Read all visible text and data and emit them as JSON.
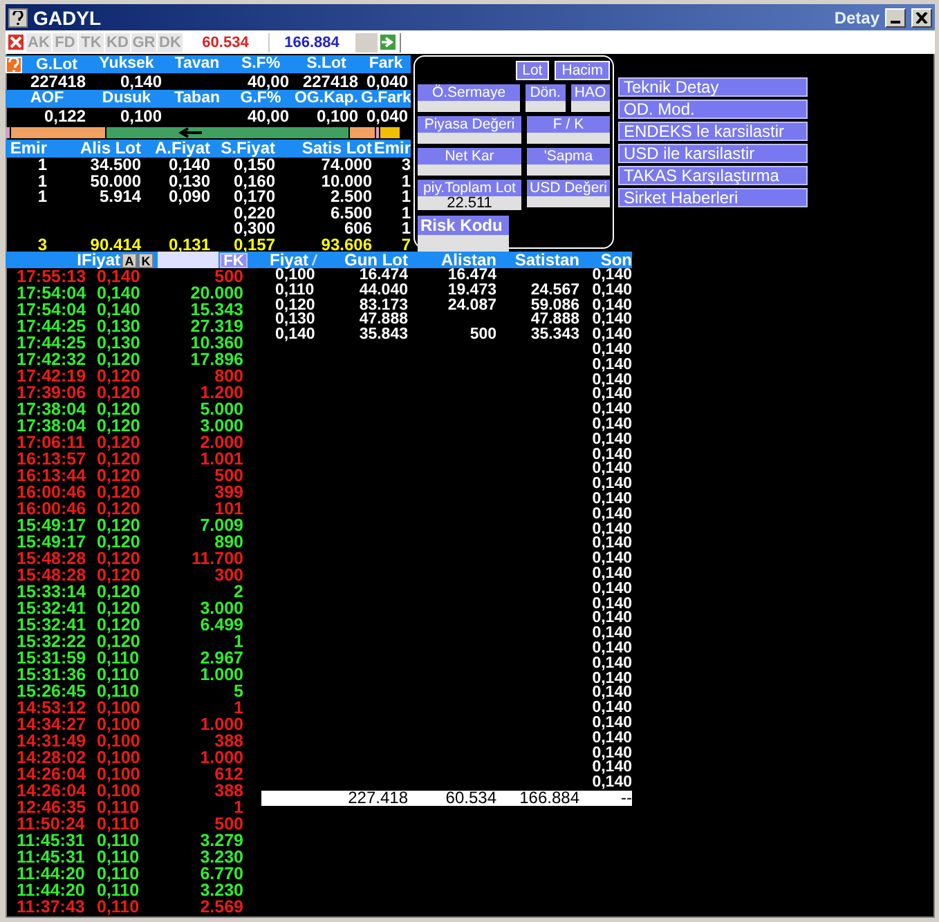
{
  "window": {
    "title": "GADYL",
    "detail_title": "Detay"
  },
  "toolbar": {
    "tabs": [
      "AK",
      "FD",
      "TK",
      "KD",
      "GR",
      "DK"
    ],
    "alistan_total": "60.534",
    "satistan_total": "166.884"
  },
  "quote": [
    {
      "label": "G.Lot",
      "value": "227418"
    },
    {
      "label": "Yuksek",
      "value": "0,140"
    },
    {
      "label": "Tavan"
    },
    {
      "label": "S.F%",
      "value": "40,00"
    },
    {
      "label": "S.Lot",
      "value": "227418"
    },
    {
      "label": "Fark",
      "value": "0,040"
    },
    {
      "label": "AOF",
      "value": "0,122"
    },
    {
      "label": "Dusuk",
      "value": "0,100"
    },
    {
      "label": "Taban"
    },
    {
      "label": "G.F%",
      "value": "40,00"
    },
    {
      "label": "OG.Kap.",
      "value": "0,100"
    },
    {
      "label": "G.Fark",
      "value": "0,040"
    }
  ],
  "depth": {
    "columns": [
      "Emir",
      "Alis Lot",
      "A.Fiyat",
      "S.Fiyat",
      "Satis Lot",
      "Emir"
    ],
    "rows": [
      {
        "emir_buy": "1",
        "alis_lot": "34.500",
        "a_fiyat": "0,140",
        "s_fiyat": "0,150",
        "satis_lot": "74.000",
        "emir_sell": "3"
      },
      {
        "emir_buy": "1",
        "alis_lot": "50.000",
        "a_fiyat": "0,130",
        "s_fiyat": "0,160",
        "satis_lot": "10.000",
        "emir_sell": "1"
      },
      {
        "emir_buy": "1",
        "alis_lot": "5.914",
        "a_fiyat": "0,090",
        "s_fiyat": "0,170",
        "satis_lot": "2.500",
        "emir_sell": "1"
      },
      {
        "s_fiyat": "0,220",
        "satis_lot": "6.500",
        "emir_sell": "1"
      },
      {
        "s_fiyat": "0,300",
        "satis_lot": "606",
        "emir_sell": "1"
      }
    ],
    "total": {
      "emir_buy": "3",
      "alis_lot": "90.414",
      "a_fiyat": "0,131",
      "s_fiyat": "0,157",
      "satis_lot": "93.606",
      "emir_sell": "7"
    }
  },
  "panel": {
    "toggles": [
      "Lot",
      "Hacim"
    ],
    "rows": [
      [
        {
          "label": "Ö.Sermaye"
        },
        {
          "label": "Dön."
        },
        {
          "label": "HAO"
        }
      ],
      [
        {
          "label": "Piyasa Değeri"
        },
        {
          "label": "F / K"
        }
      ],
      [
        {
          "label": "Net Kar"
        },
        {
          "label": "'Sapma"
        }
      ],
      [
        {
          "label": "piy.Toplam Lot",
          "value": "22.511"
        },
        {
          "label": "USD Değeri"
        }
      ]
    ],
    "risk": {
      "label": "Risk Kodu"
    }
  },
  "actions": [
    "Teknik Detay",
    "OD. Mod.",
    "ENDEKS le karsilastir",
    "USD ile karsilastir",
    "TAKAS Karşılaştırma",
    "Sirket Haberleri"
  ],
  "trades": {
    "header": "IFiyat",
    "buttons": [
      "A",
      "K"
    ],
    "filter_button": "FK",
    "rows": [
      {
        "time": "17:55:13",
        "price": "0,140",
        "lot": "500",
        "color": "#ee1a1a"
      },
      {
        "time": "17:54:04",
        "price": "0,140",
        "lot": "20.000",
        "color": "#30ee30"
      },
      {
        "time": "17:54:04",
        "price": "0,140",
        "lot": "15.343",
        "color": "#30ee30"
      },
      {
        "time": "17:44:25",
        "price": "0,130",
        "lot": "27.319",
        "color": "#30ee30"
      },
      {
        "time": "17:44:25",
        "price": "0,130",
        "lot": "10.360",
        "color": "#30ee30"
      },
      {
        "time": "17:42:32",
        "price": "0,120",
        "lot": "17.896",
        "color": "#30ee30"
      },
      {
        "time": "17:42:19",
        "price": "0,120",
        "lot": "800",
        "color": "#ee1a1a"
      },
      {
        "time": "17:39:06",
        "price": "0,120",
        "lot": "1.200",
        "color": "#ee1a1a"
      },
      {
        "time": "17:38:04",
        "price": "0,120",
        "lot": "5.000",
        "color": "#30ee30"
      },
      {
        "time": "17:38:04",
        "price": "0,120",
        "lot": "3.000",
        "color": "#30ee30"
      },
      {
        "time": "17:06:11",
        "price": "0,120",
        "lot": "2.000",
        "color": "#ee1a1a"
      },
      {
        "time": "16:13:57",
        "price": "0,120",
        "lot": "1.001",
        "color": "#ee1a1a"
      },
      {
        "time": "16:13:44",
        "price": "0,120",
        "lot": "500",
        "color": "#ee1a1a"
      },
      {
        "time": "16:00:46",
        "price": "0,120",
        "lot": "399",
        "color": "#ee1a1a"
      },
      {
        "time": "16:00:46",
        "price": "0,120",
        "lot": "101",
        "color": "#ee1a1a"
      },
      {
        "time": "15:49:17",
        "price": "0,120",
        "lot": "7.009",
        "color": "#30ee30"
      },
      {
        "time": "15:49:17",
        "price": "0,120",
        "lot": "890",
        "color": "#30ee30"
      },
      {
        "time": "15:48:28",
        "price": "0,120",
        "lot": "11.700",
        "color": "#ee1a1a"
      },
      {
        "time": "15:48:28",
        "price": "0,120",
        "lot": "300",
        "color": "#ee1a1a"
      },
      {
        "time": "15:33:14",
        "price": "0,120",
        "lot": "2",
        "color": "#30ee30"
      },
      {
        "time": "15:32:41",
        "price": "0,120",
        "lot": "3.000",
        "color": "#30ee30"
      },
      {
        "time": "15:32:41",
        "price": "0,120",
        "lot": "6.499",
        "color": "#30ee30"
      },
      {
        "time": "15:32:22",
        "price": "0,120",
        "lot": "1",
        "color": "#30ee30"
      },
      {
        "time": "15:31:59",
        "price": "0,110",
        "lot": "2.967",
        "color": "#30ee30"
      },
      {
        "time": "15:31:36",
        "price": "0,110",
        "lot": "1.000",
        "color": "#30ee30"
      },
      {
        "time": "15:26:45",
        "price": "0,110",
        "lot": "5",
        "color": "#30ee30"
      },
      {
        "time": "14:53:12",
        "price": "0,100",
        "lot": "1",
        "color": "#ee1a1a"
      },
      {
        "time": "14:34:27",
        "price": "0,100",
        "lot": "1.000",
        "color": "#ee1a1a"
      },
      {
        "time": "14:31:49",
        "price": "0,100",
        "lot": "388",
        "color": "#ee1a1a"
      },
      {
        "time": "14:28:02",
        "price": "0,100",
        "lot": "1.000",
        "color": "#ee1a1a"
      },
      {
        "time": "14:26:04",
        "price": "0,100",
        "lot": "612",
        "color": "#ee1a1a"
      },
      {
        "time": "14:26:04",
        "price": "0,100",
        "lot": "388",
        "color": "#ee1a1a"
      },
      {
        "time": "12:46:35",
        "price": "0,110",
        "lot": "1",
        "color": "#ee1a1a"
      },
      {
        "time": "11:50:24",
        "price": "0,110",
        "lot": "500",
        "color": "#ee1a1a"
      },
      {
        "time": "11:45:31",
        "price": "0,110",
        "lot": "3.279",
        "color": "#30ee30"
      },
      {
        "time": "11:45:31",
        "price": "0,110",
        "lot": "3.230",
        "color": "#30ee30"
      },
      {
        "time": "11:44:20",
        "price": "0,110",
        "lot": "6.770",
        "color": "#30ee30"
      },
      {
        "time": "11:44:20",
        "price": "0,110",
        "lot": "3.230",
        "color": "#30ee30"
      },
      {
        "time": "11:37:43",
        "price": "0,110",
        "lot": "2.569",
        "color": "#ee1a1a"
      }
    ]
  },
  "price_table": {
    "columns": [
      "Fiyat",
      "Gun Lot",
      "Alistan",
      "Satistan",
      "Son"
    ],
    "rows": [
      {
        "fiyat": "0,100",
        "gun_lot": "16.474",
        "alistan": "16.474",
        "son": "0,140"
      },
      {
        "fiyat": "0,110",
        "gun_lot": "44.040",
        "alistan": "19.473",
        "satistan": "24.567",
        "son": "0,140"
      },
      {
        "fiyat": "0,120",
        "gun_lot": "83.173",
        "alistan": "24.087",
        "satistan": "59.086",
        "son": "0,140"
      },
      {
        "fiyat": "0,130",
        "gun_lot": "47.888",
        "satistan": "47.888",
        "son": "0,140"
      },
      {
        "fiyat": "0,140",
        "gun_lot": "35.843",
        "alistan": "500",
        "satistan": "35.343",
        "son": "0,140"
      }
    ],
    "son_only": [
      "0,140",
      "0,140",
      "0,140",
      "0,140",
      "0,140",
      "0,140",
      "0,140",
      "0,140",
      "0,140",
      "0,140",
      "0,140",
      "0,140",
      "0,140",
      "0,140",
      "0,140",
      "0,140",
      "0,140",
      "0,140",
      "0,140",
      "0,140",
      "0,140",
      "0,140",
      "0,140",
      "0,140",
      "0,140",
      "0,140",
      "0,140",
      "0,140",
      "0,140",
      "0,140"
    ],
    "total": {
      "gun_lot": "227.418",
      "alistan": "60.534",
      "satistan": "166.884",
      "son": "--"
    }
  }
}
